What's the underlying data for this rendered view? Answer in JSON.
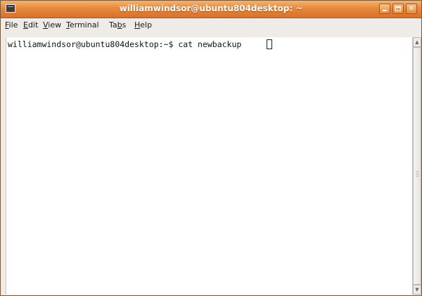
{
  "window": {
    "title": "williamwindsor@ubuntu804desktop: ~",
    "accent_color": "#e8893a"
  },
  "menu": {
    "items": [
      {
        "mnemonic": "F",
        "rest": "ile"
      },
      {
        "mnemonic": "E",
        "rest": "dit"
      },
      {
        "mnemonic": "V",
        "rest": "iew"
      },
      {
        "mnemonic": "T",
        "rest": "erminal"
      },
      {
        "pre": "Ta",
        "mnemonic": "b",
        "rest": "s"
      },
      {
        "mnemonic": "H",
        "rest": "elp"
      }
    ]
  },
  "terminal": {
    "line": "williamwindsor@ubuntu804desktop:~$ cat newbackup"
  },
  "icons": {
    "app": "terminal-icon",
    "minimize": "minimize-icon",
    "maximize": "maximize-icon",
    "close": "close-icon",
    "scroll_up": "scroll-up-arrow-icon",
    "scroll_down": "scroll-down-arrow-icon"
  }
}
